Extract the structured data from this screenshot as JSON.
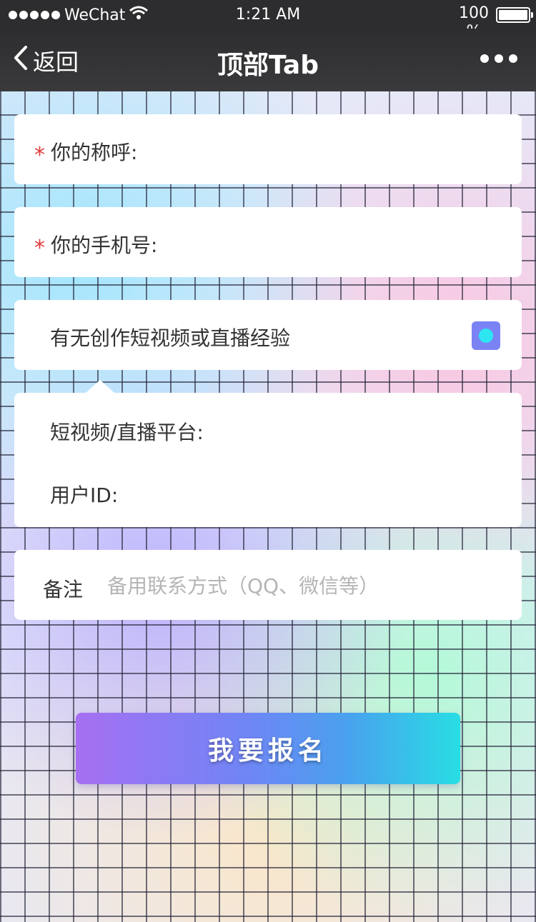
{
  "status_bar": {
    "carrier": "WeChat",
    "time": "1:21 AM",
    "battery_text": "100\n%"
  },
  "nav": {
    "back_label": "返回",
    "title": "顶部Tab"
  },
  "form": {
    "name_label": "你的称呼:",
    "phone_label": "你的手机号:",
    "experience_label": "有无创作短视频或直播经验",
    "experience_toggle_on": true,
    "platform_label": "短视频/直播平台:",
    "user_id_label": "用户ID:",
    "remark_label": "备注",
    "remark_placeholder": "备用联系方式（QQ、微信等）",
    "remark_value": "",
    "submit_label": "我要报名"
  },
  "colors": {
    "required_mark": "#e03a3a",
    "toggle_bg": "#7b83f4",
    "toggle_knob": "#2de6f2",
    "button_start": "#a66ff2",
    "button_end": "#28dde4"
  },
  "icons": {
    "required": "*",
    "back": "chevron-left-icon",
    "more": "ellipsis-icon"
  }
}
